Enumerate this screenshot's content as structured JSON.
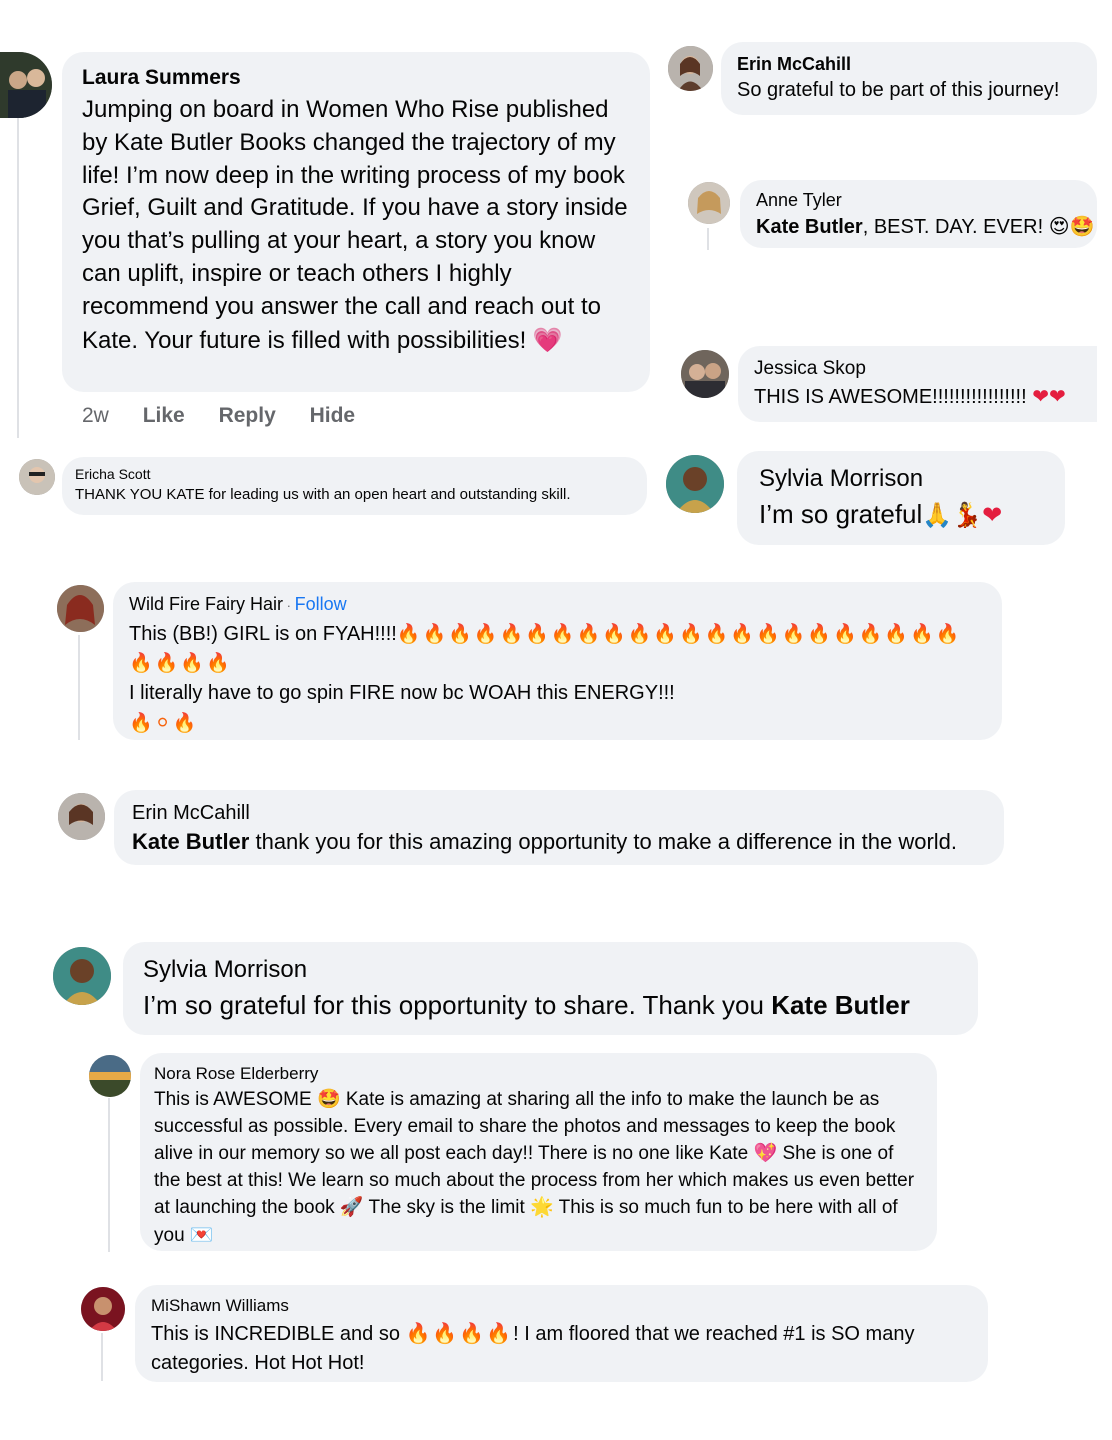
{
  "comments": {
    "laura": {
      "name": "Laura Summers",
      "text": "Jumping on board in Women Who Rise published by Kate Butler Books changed the trajectory of my life! I’m now deep in the writing process of my book Grief, Guilt and Gratitude. If you have a story inside you that’s pulling at your heart, a story you know can uplift, inspire or teach others I highly recommend you answer the call and reach out to Kate. Your future is filled with possibilities!",
      "emoji": "💗",
      "time": "2w",
      "like": "Like",
      "reply": "Reply",
      "hide": "Hide"
    },
    "erin1": {
      "name": "Erin McCahill",
      "text": "So grateful to be part of this journey!"
    },
    "anne": {
      "name": "Anne Tyler",
      "mention": "Kate Butler",
      "text": ", BEST. DAY. EVER!",
      "emoji": "😍🤩"
    },
    "jessica": {
      "name": "Jessica Skop",
      "text": "THIS IS AWESOME!!!!!!!!!!!!!!!!!",
      "emoji": "❤❤"
    },
    "ericha": {
      "name": "Ericha Scott",
      "text": "THANK YOU KATE for leading us with an open heart and outstanding skill."
    },
    "sylvia1": {
      "name": "Sylvia Morrison",
      "text": "I’m so grateful",
      "emoji": "🙏💃❤"
    },
    "wildfire": {
      "name": "Wild Fire Fairy Hair",
      "separator": " · ",
      "follow": "Follow",
      "line1": "This (BB!) GIRL is on FYAH!!!!",
      "fire_line1": "🔥🔥🔥🔥🔥🔥🔥🔥🔥🔥🔥🔥🔥🔥🔥🔥🔥🔥🔥🔥🔥🔥",
      "fire_line2": "🔥🔥🔥🔥",
      "line3": "I literally have to go spin FIRE now bc WOAH this ENERGY!!!",
      "fire_line4": "🔥⚪🔥"
    },
    "erin2": {
      "name": "Erin McCahill",
      "mention": "Kate Butler",
      "text": " thank you for this amazing opportunity to make a difference in the world."
    },
    "sylvia2": {
      "name": "Sylvia Morrison",
      "text": "I’m so grateful for this opportunity to share. Thank you ",
      "mention": "Kate Butler"
    },
    "nora": {
      "name": "Nora Rose Elderberry",
      "p1": "This is AWESOME ",
      "e1": "🤩",
      "p2": " Kate is amazing at sharing all the info to make the launch be as successful as possible. Every email to share the photos and messages to keep the book alive in our memory so we all post each day!! There is no one like Kate ",
      "e2": "💖",
      "p3": " She is one of the best at this! We learn so much about the process from her which makes us even better at launching the book ",
      "e3": "🚀",
      "p4": " The sky is the limit ",
      "e4": "🌟",
      "p5": " This is so much fun to be here with all of you ",
      "e5": "💌"
    },
    "mishawn": {
      "name": "MiShawn Williams",
      "p1": "This is INCREDIBLE and so ",
      "fire": "🔥🔥🔥🔥",
      "p2": "! I am floored that we reached #1 is SO many categories. Hot Hot Hot!"
    }
  },
  "colors": {
    "bubble": "#f0f2f5",
    "text": "#050505",
    "muted": "#65676b",
    "link": "#1877f2"
  }
}
